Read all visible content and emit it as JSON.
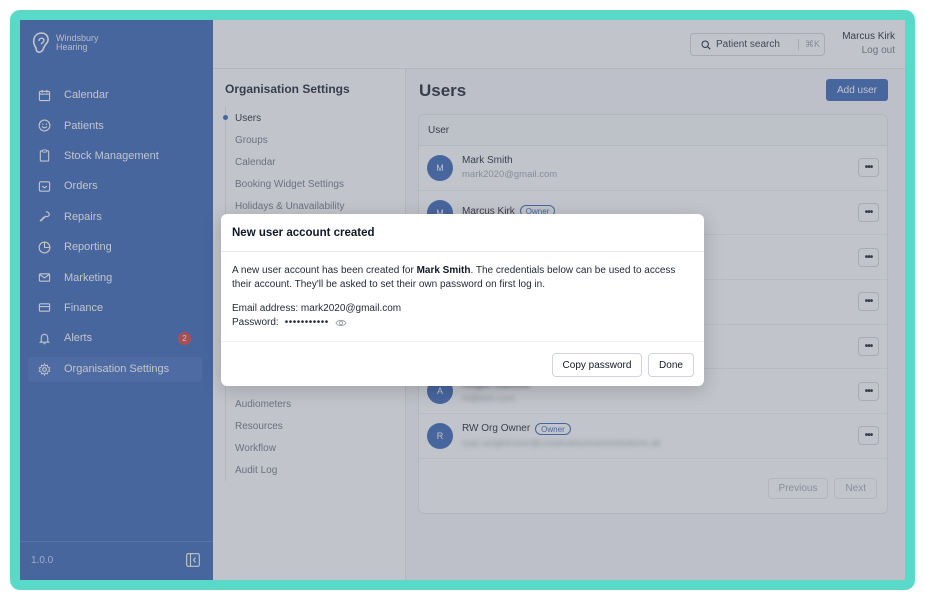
{
  "brand": {
    "line1": "Windsbury",
    "line2": "Hearing",
    "color": "#2f5db3"
  },
  "sidebar": {
    "items": [
      {
        "label": "Calendar",
        "icon": "calendar-icon"
      },
      {
        "label": "Patients",
        "icon": "smiley-icon"
      },
      {
        "label": "Stock Management",
        "icon": "clipboard-icon"
      },
      {
        "label": "Orders",
        "icon": "inbox-icon"
      },
      {
        "label": "Repairs",
        "icon": "wrench-icon"
      },
      {
        "label": "Reporting",
        "icon": "pie-chart-icon"
      },
      {
        "label": "Marketing",
        "icon": "mail-icon"
      },
      {
        "label": "Finance",
        "icon": "card-icon"
      },
      {
        "label": "Alerts",
        "icon": "bell-icon",
        "badge": "2"
      },
      {
        "label": "Organisation Settings",
        "icon": "gear-icon",
        "active": true
      }
    ],
    "version": "1.0.0"
  },
  "header": {
    "search_label": "Patient search",
    "search_shortcut": "⌘K",
    "user_name": "Marcus Kirk",
    "logout": "Log out"
  },
  "settings": {
    "title": "Organisation Settings",
    "items": [
      "Users",
      "Groups",
      "Calendar",
      "Booking Widget Settings",
      "Holidays & Unavailability",
      "",
      "",
      "",
      "",
      "",
      "",
      "",
      "",
      "Audiometers",
      "Resources",
      "Workflow",
      "Audit Log"
    ]
  },
  "main": {
    "title": "Users",
    "add_user": "Add user",
    "column_user": "User",
    "rows": [
      {
        "initial": "M",
        "name": "Mark Smith",
        "email": "mark2020@gmail.com",
        "owner": "",
        "blur": false
      },
      {
        "initial": "M",
        "name": "Marcus Kirk",
        "email": "",
        "owner": "Owner",
        "blur": false
      },
      {
        "initial": "",
        "name": "",
        "email": "",
        "owner": "",
        "blur": false
      },
      {
        "initial": "",
        "name": "",
        "email": "",
        "owner": "",
        "blur": false
      },
      {
        "initial": "",
        "name": "",
        "email": "",
        "owner": "",
        "blur": false
      },
      {
        "initial": "A",
        "name": "Abigail Radcliffe",
        "email": "hi@test.com",
        "owner": "",
        "blur": true
      },
      {
        "initial": "R",
        "name": "RW Org Owner",
        "email": "ryan.wrightmoor@creativebusinesssolutions.uk",
        "owner": "Owner",
        "blur": true
      }
    ],
    "pager": {
      "previous": "Previous",
      "next": "Next"
    }
  },
  "modal": {
    "title": "New user account created",
    "body_prefix": "A new user account has been created for ",
    "body_name": "Mark Smith",
    "body_suffix": ". The credentials below can be used to access their account. They'll be asked to set their own password on first log in.",
    "email_label": "Email address:",
    "email_value": "mark2020@gmail.com",
    "password_label": "Password:",
    "password_mask": "•••••••••••",
    "copy_button": "Copy password",
    "done_button": "Done"
  }
}
